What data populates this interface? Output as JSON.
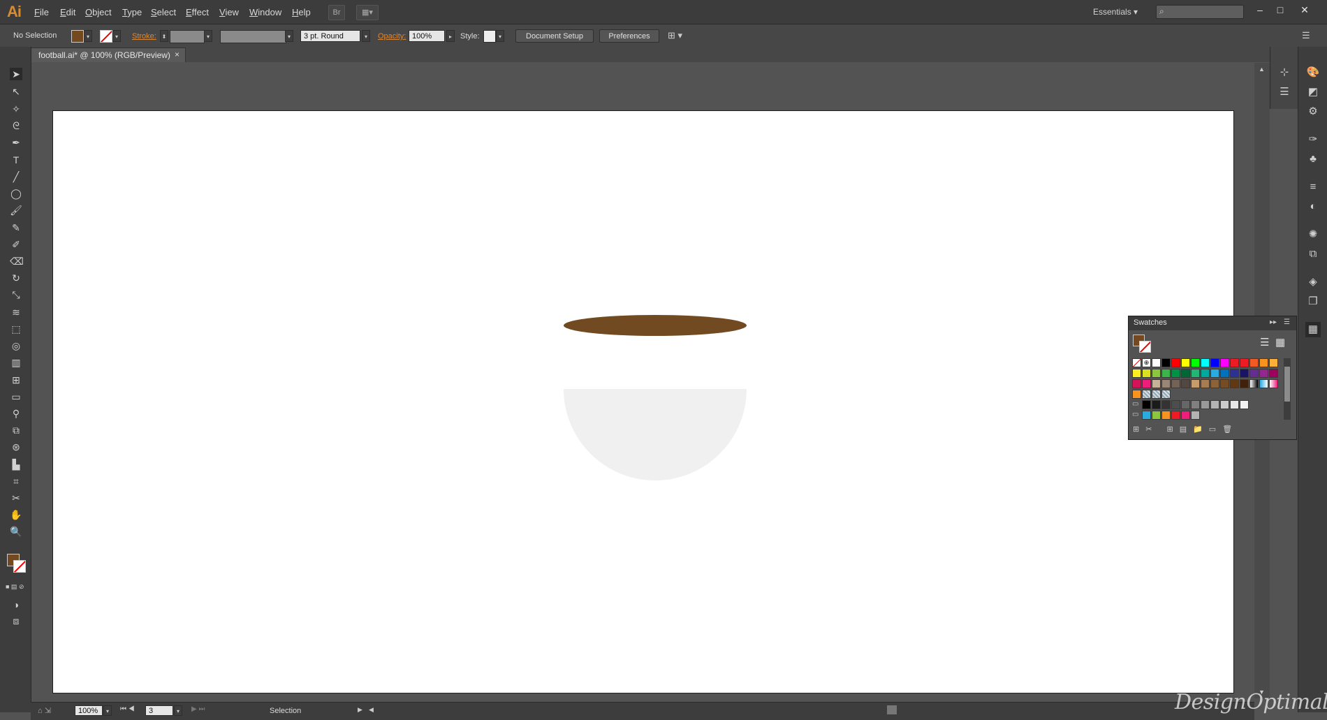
{
  "app": {
    "logo": "Ai"
  },
  "menu": [
    "File",
    "Edit",
    "Object",
    "Type",
    "Select",
    "Effect",
    "View",
    "Window",
    "Help"
  ],
  "menu_right": {
    "workspace": "Essentials",
    "search_placeholder": "⌕"
  },
  "window_controls": {
    "minimize": "–",
    "restore": "□",
    "close": "✕"
  },
  "controlbar": {
    "selection_status": "No Selection",
    "stroke_label": "Stroke:",
    "brush_value": "3 pt. Round",
    "opacity_label": "Opacity:",
    "opacity_value": "100%",
    "style_label": "Style:",
    "document_setup": "Document Setup",
    "preferences": "Preferences"
  },
  "document": {
    "tab_title": "football.ai* @ 100% (RGB/Preview)",
    "close": "×"
  },
  "artwork": {
    "ellipse_color": "#724a22",
    "bowl_color": "#f0f0f0"
  },
  "fill_color": "#74491f",
  "statusbar": {
    "zoom": "100%",
    "artboard_num": "3",
    "tool": "Selection"
  },
  "swatches": {
    "title": "Swatches",
    "rows": [
      [
        "none",
        "reg",
        "#ffffff",
        "#000000",
        "#ff0000",
        "#ffff00",
        "#00ff00",
        "#00ffff",
        "#0000ff",
        "#ff00ff",
        "#ed1c24",
        "#ed1c24",
        "#f15a24",
        "#f7931e",
        "#fbb03b"
      ],
      [
        "#fcee21",
        "#d9e021",
        "#8cc63f",
        "#39b54a",
        "#009245",
        "#006837",
        "#22b573",
        "#00a99d",
        "#29abe2",
        "#0071bc",
        "#2e3192",
        "#1b1464",
        "#662d91",
        "#93278f",
        "#9e005d"
      ],
      [
        "#d4145a",
        "#ed1e79",
        "#c7b299",
        "#998675",
        "#736357",
        "#534741",
        "#c69c6d",
        "#a67c52",
        "#8c6239",
        "#754c24",
        "#603813",
        "#42210b",
        "grad-bw",
        "grad-blue",
        "grad-pink"
      ],
      [
        "#f7931e",
        "pattern1",
        "pattern2",
        "pattern3"
      ],
      [
        "folder",
        "#000000",
        "#1a1a1a",
        "#333333",
        "#4d4d4d",
        "#666666",
        "#808080",
        "#999999",
        "#b3b3b3",
        "#cccccc",
        "#e6e6e6",
        "#f2f2f2"
      ],
      [
        "folder",
        "#29abe2",
        "#8cc63f",
        "#f7931e",
        "#ed1c24",
        "#ed1e79",
        "#b3b3b3"
      ]
    ]
  },
  "watermark": "DesignOptimal.com"
}
